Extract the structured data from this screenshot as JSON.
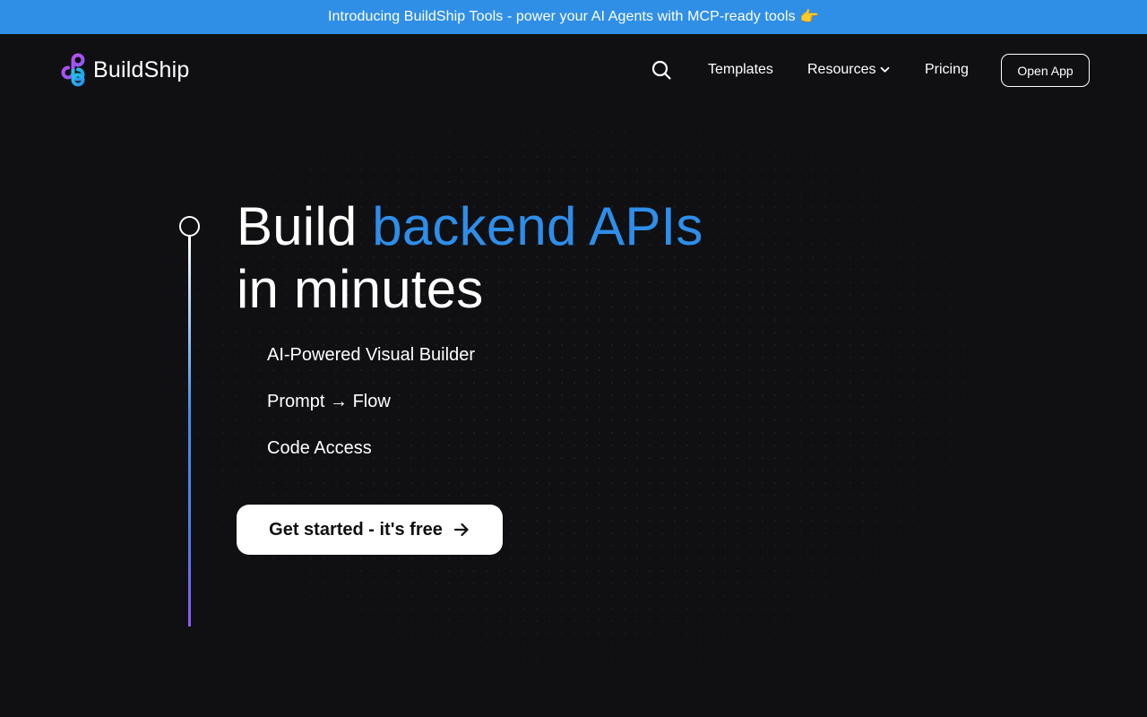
{
  "announcement": {
    "text": "Introducing BuildShip Tools - power your AI Agents with MCP-ready tools",
    "emoji": "👉"
  },
  "nav": {
    "brand": "BuildShip",
    "search_icon": "search-icon",
    "links": [
      "Templates",
      "Resources",
      "Pricing"
    ],
    "open_app": "Open App"
  },
  "hero": {
    "headline_plain": "Build",
    "headline_accent": "backend APIs",
    "headline_line2": "in minutes",
    "features": [
      "AI-Powered Visual Builder",
      "Prompt → Flow",
      "Code Access"
    ],
    "cta_label": "Get started - it's free"
  },
  "colors": {
    "announcement_bg": "#2f8fe6",
    "background": "#101013",
    "accent": "#2e8ee9",
    "timeline_end": "#8b5cf6"
  }
}
